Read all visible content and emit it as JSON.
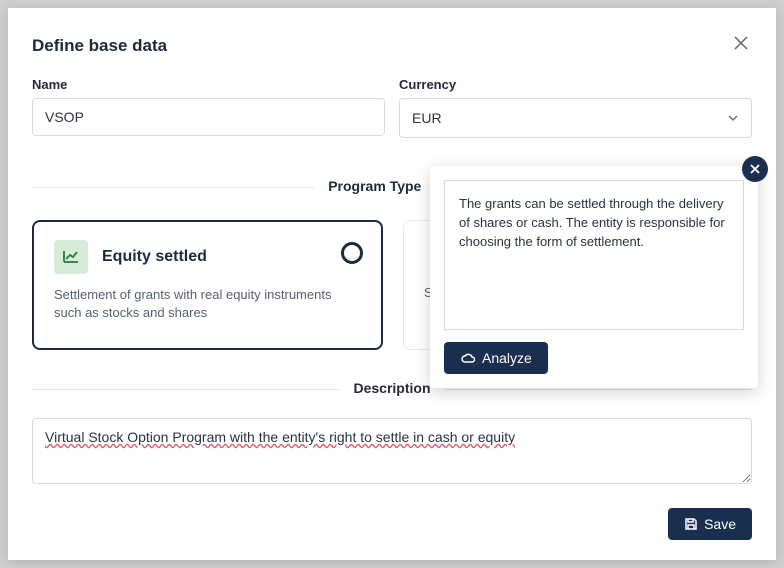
{
  "modal": {
    "title": "Define base data"
  },
  "fields": {
    "nameLabel": "Name",
    "nameValue": "VSOP",
    "currencyLabel": "Currency",
    "currencyValue": "EUR"
  },
  "programType": {
    "sectionLabel": "Program Type",
    "cards": {
      "equity": {
        "title": "Equity settled",
        "desc": "Settlement of grants with real equity instruments such as stocks and shares"
      },
      "other": {
        "partial": "Se"
      }
    }
  },
  "descriptionSection": {
    "label": "Description",
    "value": "Virtual Stock Option Program with the entity's right to settle in cash or equity"
  },
  "tooltip": {
    "text": "The grants can be settled through the delivery of shares or cash. The entity is responsible for choosing the form of settlement.",
    "analyzeLabel": "Analyze"
  },
  "actions": {
    "save": "Save"
  },
  "icons": {
    "badge": "✦"
  }
}
